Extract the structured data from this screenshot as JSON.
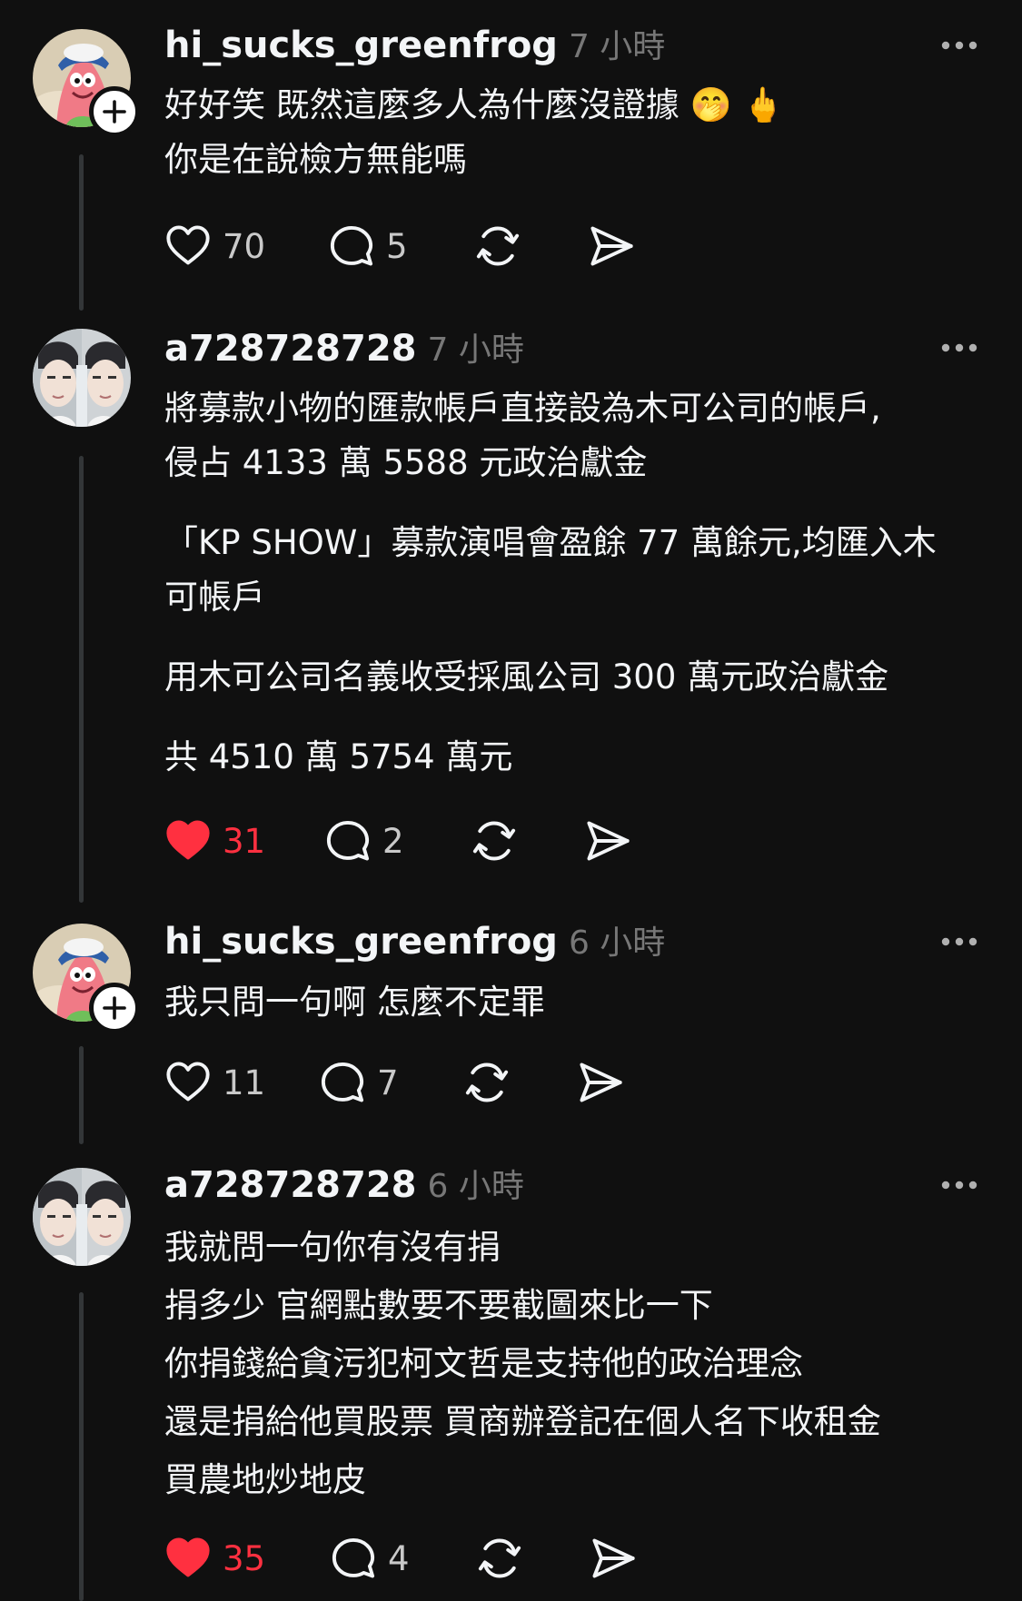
{
  "colors": {
    "background": "#101010",
    "text_primary": "#f3f5f7",
    "text_secondary": "#777777",
    "liked_red": "#ff3040",
    "thread_line": "#333638"
  },
  "posts": [
    {
      "username": "hi_sucks_greenfrog",
      "time": "7 小時",
      "avatar": "patrick-star-avatar",
      "has_follow_button": true,
      "paragraphs": [
        "好好笑 既然這麼多人為什麼沒證據 🤭 🖕\n你是在說檢方無能嗎"
      ],
      "likes": "70",
      "liked": false,
      "replies": "5"
    },
    {
      "username": "a728728728",
      "time": "7 小時",
      "avatar": "mirrored-face-avatar",
      "has_follow_button": false,
      "paragraphs": [
        "將募款小物的匯款帳戶直接設為木可公司的帳戶,\n侵占 4133 萬 5588 元政治獻金",
        "「KP SHOW」募款演唱會盈餘 77 萬餘元,均匯入木\n可帳戶",
        "用木可公司名義收受採風公司 300 萬元政治獻金",
        "共 4510 萬 5754 萬元"
      ],
      "likes": "31",
      "liked": true,
      "replies": "2"
    },
    {
      "username": "hi_sucks_greenfrog",
      "time": "6 小時",
      "avatar": "patrick-star-avatar",
      "has_follow_button": true,
      "paragraphs": [
        "我只問一句啊 怎麼不定罪"
      ],
      "likes": "11",
      "liked": false,
      "replies": "7"
    },
    {
      "username": "a728728728",
      "time": "6 小時",
      "avatar": "mirrored-face-avatar",
      "has_follow_button": false,
      "paragraphs": [
        "我就問一句你有沒有捐\n捐多少 官網點數要不要截圖來比一下\n你捐錢給貪污犯柯文哲是支持他的政治理念\n還是捐給他買股票 買商辦登記在個人名下收租金\n買農地炒地皮"
      ],
      "likes": "35",
      "liked": true,
      "replies": "4"
    }
  ]
}
